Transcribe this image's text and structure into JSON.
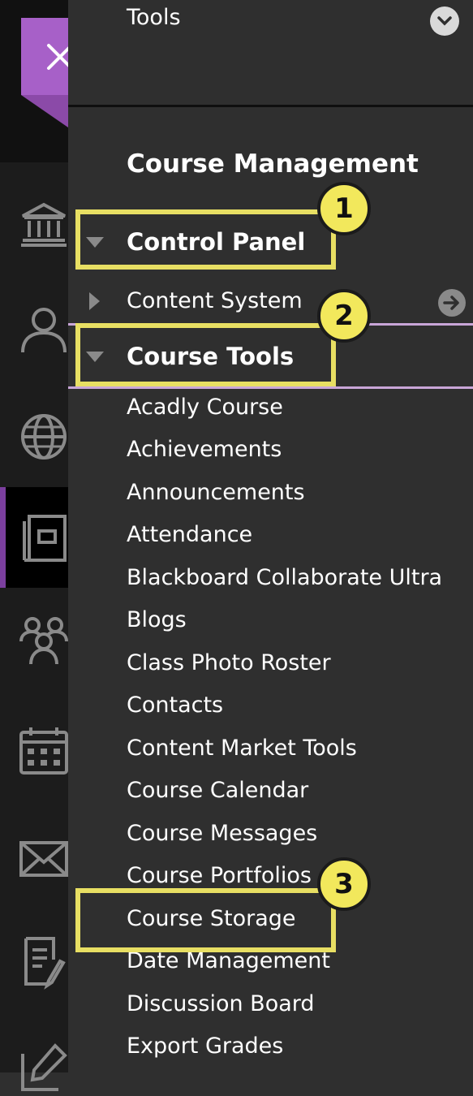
{
  "header": {
    "tools_label": "Tools"
  },
  "section": {
    "title": "Course Management"
  },
  "control_panel": {
    "label": "Control Panel",
    "badge": "1"
  },
  "content_system": {
    "label": "Content System"
  },
  "course_tools": {
    "label": "Course Tools",
    "badge": "2"
  },
  "tools_list": [
    "Acadly Course",
    "Achievements",
    "Announcements",
    "Attendance",
    "Blackboard Collaborate Ultra",
    "Blogs",
    "Class Photo Roster",
    "Contacts",
    "Content Market Tools",
    "Course Calendar",
    "Course Messages",
    "Course Portfolios",
    "Course Storage",
    "Date Management",
    "Discussion Board",
    "Export Grades"
  ],
  "course_storage_badge": "3",
  "colors": {
    "highlight": "#e8df63",
    "accent": "#a760c8",
    "panel_bg": "#2f2f2f",
    "rail_bg": "#1c1c1c"
  },
  "icons": [
    "close-icon",
    "institution-icon",
    "profile-icon",
    "globe-icon",
    "courses-icon",
    "groups-icon",
    "calendar-icon",
    "messages-icon",
    "grades-icon",
    "edit-icon",
    "chevron-down-icon",
    "arrow-right-icon"
  ]
}
